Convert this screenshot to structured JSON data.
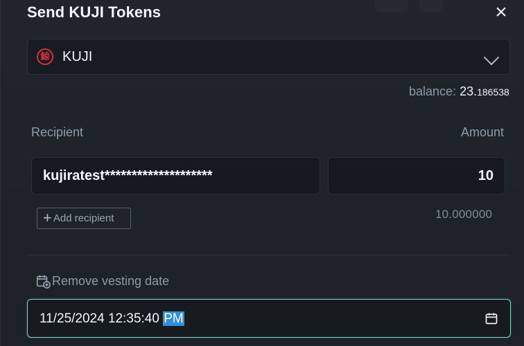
{
  "modal": {
    "title": "Send KUJI Tokens",
    "close_icon": "close-icon"
  },
  "token_select": {
    "icon": "kuji-token-icon",
    "icon_glyph": "鯨",
    "value": "KUJI",
    "chevron_icon": "chevron-down-icon"
  },
  "balance": {
    "label": "balance:",
    "main": "23.",
    "decimals": "186538"
  },
  "recipient": {
    "label": "Recipient",
    "value": "kujiratest********************"
  },
  "amount": {
    "label": "Amount",
    "value": "10",
    "formatted": "10.000000"
  },
  "actions": {
    "add_recipient_icon": "plus-icon",
    "add_recipient_label": "Add recipient",
    "remove_vesting_icon": "calendar-plus-icon",
    "remove_vesting_label": "Remove vesting date"
  },
  "vesting_date": {
    "date_time": "11/25/2024 12:35:40",
    "meridiem": "PM",
    "calendar_icon": "calendar-icon"
  },
  "colors": {
    "background": "#1f242b",
    "panel": "#171b22",
    "accent_outline": "#7ad7b7",
    "token_red": "#e02d3b",
    "selection_blue": "#2f8fde"
  }
}
